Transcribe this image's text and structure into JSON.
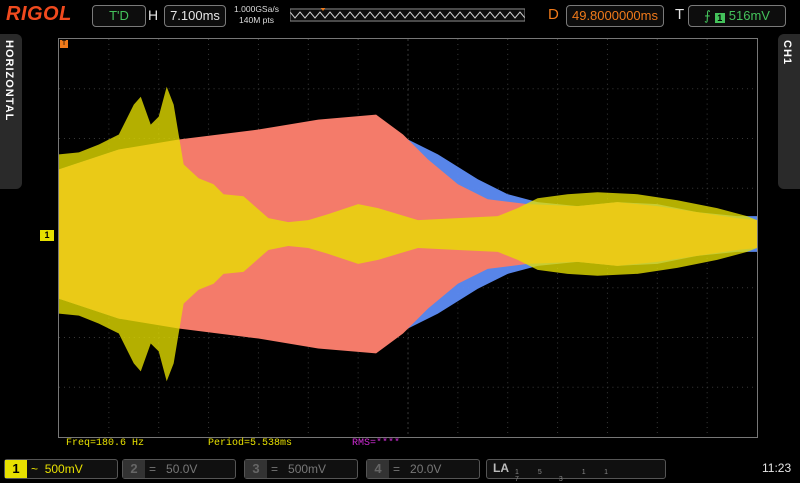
{
  "header": {
    "brand": "RIGOL",
    "run_state": "T'D",
    "h_label": "H",
    "timebase": "7.100ms",
    "sample_rate": "1.000GSa/s",
    "memory_depth": "140M pts",
    "d_label": "D",
    "delay": "49.8000000ms",
    "t_label": "T",
    "trigger_level": "516mV"
  },
  "side_tabs": {
    "left": "HORIZONTAL",
    "right": "CH1"
  },
  "markers": {
    "channel1": "1",
    "trigger": "T"
  },
  "measurements": {
    "freq": "Freq=180.6 Hz",
    "period": "Period=5.538ms",
    "rms": "RMS=****"
  },
  "channels": [
    {
      "num": "1",
      "coupling": "~",
      "scale": "500mV"
    },
    {
      "num": "2",
      "coupling": "=",
      "scale": "50.0V"
    },
    {
      "num": "3",
      "coupling": "=",
      "scale": "500mV"
    },
    {
      "num": "4",
      "coupling": "=",
      "scale": "20.0V"
    }
  ],
  "la": {
    "label": "LA",
    "nums": "15 11 7 3"
  },
  "clock": "11:23",
  "colors": {
    "ch1": "#e7e000",
    "ref_red": "#f47b6a",
    "ref_blue": "#5d8cf5",
    "trigger": "#f07a1a"
  }
}
